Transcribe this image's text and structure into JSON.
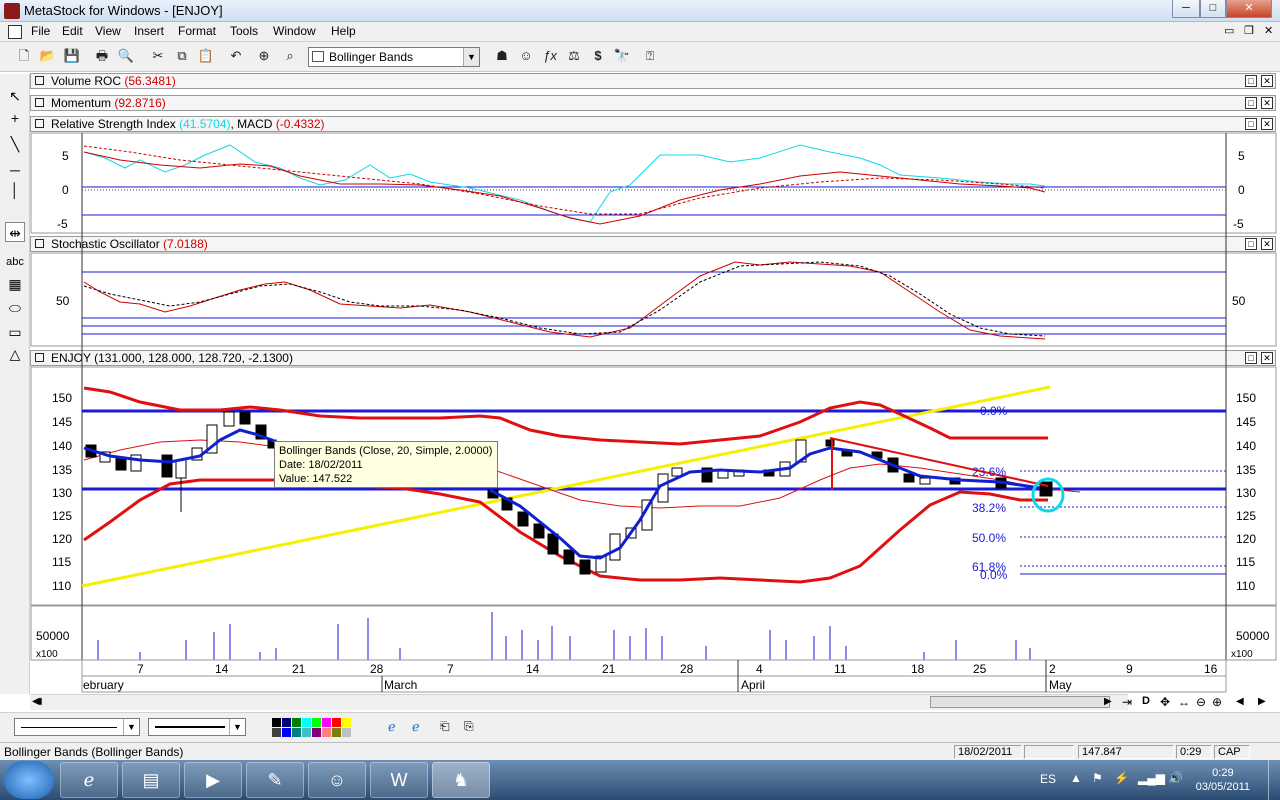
{
  "window": {
    "title": "MetaStock for Windows - [ENJOY]",
    "controls": {
      "minimize": "─",
      "maximize": "□",
      "close": "✕"
    }
  },
  "menu": [
    "File",
    "Edit",
    "View",
    "Insert",
    "Format",
    "Tools",
    "Window",
    "Help"
  ],
  "toolbar": {
    "indicator_select": "Bollinger Bands"
  },
  "panes": {
    "volume_roc": {
      "name": "Volume ROC",
      "value": "(56.3481)"
    },
    "momentum": {
      "name": "Momentum",
      "value": "(92.8716)"
    },
    "rsi_macd": {
      "name": "Relative Strength Index",
      "rsi_value": "(41.5704)",
      "macd_name": ", MACD",
      "macd_value": "(-0.4332)"
    },
    "stochastic": {
      "name": "Stochastic Oscillator",
      "value": "(7.0188)"
    },
    "price": {
      "name": "ENJOY",
      "value": "(131.000, 128.000, 128.720, -2.1300)"
    },
    "volume": {
      "tick_label": "50000",
      "scale": "x100"
    }
  },
  "axes": {
    "macd_ticks": [
      "5",
      "0",
      "-5"
    ],
    "stoch_ticks": [
      "50"
    ],
    "price_ticks": [
      "150",
      "145",
      "140",
      "135",
      "130",
      "125",
      "120",
      "115",
      "110"
    ],
    "date_ticks": [
      "7",
      "14",
      "21",
      "28",
      "7",
      "14",
      "21",
      "28",
      "4",
      "11",
      "18",
      "25",
      "2",
      "9",
      "16"
    ],
    "month_labels": [
      "ebruary",
      "March",
      "April",
      "May"
    ]
  },
  "fibonacci": [
    "0.0%",
    "23.6%",
    "38.2%",
    "50.0%",
    "61.8%",
    "0.0%"
  ],
  "tooltip": {
    "line1": "Bollinger Bands (Close, 20, Simple, 2.0000)",
    "line2": "Date: 18/02/2011",
    "line3": "Value: 147.522"
  },
  "status": {
    "message": "Bollinger Bands (Bollinger Bands)",
    "date": "18/02/2011",
    "value": "147.847",
    "time": "0:29",
    "cap": "CAP"
  },
  "taskbar": {
    "lang": "ES",
    "clock_time": "0:29",
    "clock_date": "03/05/2011"
  },
  "colors": {
    "band_red": "#e01010",
    "ma_blue": "#1020d0",
    "trend_yellow": "#f5f000",
    "hline_blue": "#1a1ad8",
    "rsi_cyan": "#10d8e8"
  },
  "chart_data": {
    "type": "line",
    "x_labels": [
      "7",
      "14",
      "21",
      "28",
      "7",
      "14",
      "21",
      "28",
      "4",
      "11",
      "18",
      "25",
      "2"
    ],
    "price_ylim": [
      107,
      153
    ],
    "series": [
      {
        "name": "",
        "values": [
          152,
          151,
          149,
          148,
          147,
          146,
          146,
          146,
          146,
          146,
          145,
          142,
          141,
          143,
          148,
          144,
          141
        ]
      },
      {
        "name": "",
        "values": [
          120,
          126,
          130,
          130,
          130,
          130,
          130,
          129,
          122,
          112,
          110,
          110,
          111,
          111,
          111,
          110,
          120
        ]
      }
    ]
  }
}
